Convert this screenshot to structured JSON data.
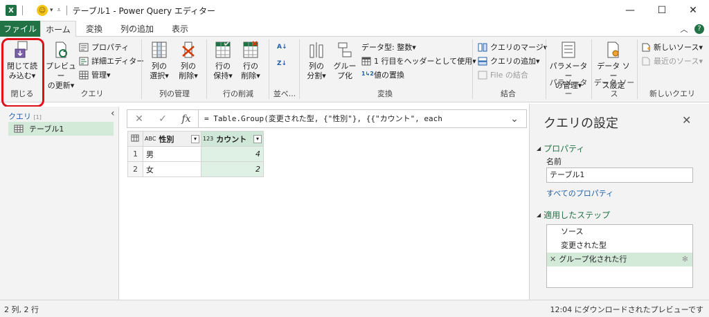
{
  "window": {
    "title": "テーブル1 - Power Query エディター",
    "app_icon": "X",
    "colors": {
      "excel_green": "#217346",
      "accent_green": "#1e7145",
      "highlight": "#e0101a"
    }
  },
  "tabs": [
    "ファイル",
    "ホーム",
    "変換",
    "列の追加",
    "表示"
  ],
  "ribbon": {
    "close": {
      "label1": "閉じて読",
      "label2": "み込む",
      "group": "閉じる"
    },
    "query": {
      "preview_line1": "プレビュー",
      "preview_line2": "の更新",
      "properties": "プロパティ",
      "advanced_editor": "詳細エディター",
      "manage": "管理",
      "group": "クエリ"
    },
    "manage_columns": {
      "choose_l1": "列の",
      "choose_l2": "選択",
      "remove_l1": "列の",
      "remove_l2": "削除",
      "group": "列の管理"
    },
    "reduce_rows": {
      "keep_l1": "行の",
      "keep_l2": "保持",
      "remove_l1": "行の",
      "remove_l2": "削除",
      "group": "行の削減"
    },
    "sort": {
      "group": "並べ..."
    },
    "transform": {
      "split_l1": "列の",
      "split_l2": "分割",
      "groupby_l1": "グルー",
      "groupby_l2": "プ化",
      "data_type": "データ型: 整数",
      "first_row_header": "1 行目をヘッダーとして使用",
      "replace_values": "値の置換",
      "group": "変換"
    },
    "combine": {
      "merge": "クエリのマージ",
      "append": "クエリの追加",
      "combine_files": "File の結合",
      "group": "結合"
    },
    "parameters": {
      "manage_l1": "パラメーター",
      "manage_l2": "の管理",
      "group": "パラメーター"
    },
    "datasource": {
      "l1": "データ ソー",
      "l2": "ス設定",
      "group": "データ ソース"
    },
    "newquery": {
      "new_source": "新しいソース",
      "recent_sources": "最近のソース",
      "group": "新しいクエリ"
    }
  },
  "queries": {
    "header": "クエリ",
    "count": "[1]",
    "items": [
      "テーブル1"
    ]
  },
  "formula": {
    "fx": "fx",
    "text": "= Table.Group(変更された型, {\"性別\"}, {{\"カウント\", each"
  },
  "grid": {
    "columns": [
      {
        "type_icon": "ABC",
        "name": "性別"
      },
      {
        "type_icon": "123",
        "name": "カウント"
      }
    ],
    "rows": [
      {
        "index": "1",
        "gender": "男",
        "count": "4"
      },
      {
        "index": "2",
        "gender": "女",
        "count": "2"
      }
    ]
  },
  "settings": {
    "title": "クエリの設定",
    "properties_header": "プロパティ",
    "name_label": "名前",
    "name_value": "テーブル1",
    "all_properties": "すべてのプロパティ",
    "steps_header": "適用したステップ",
    "steps": [
      "ソース",
      "変更された型",
      "グループ化された行"
    ]
  },
  "status": {
    "left": "2 列, 2 行",
    "right": "12:04 にダウンロードされたプレビューです"
  }
}
